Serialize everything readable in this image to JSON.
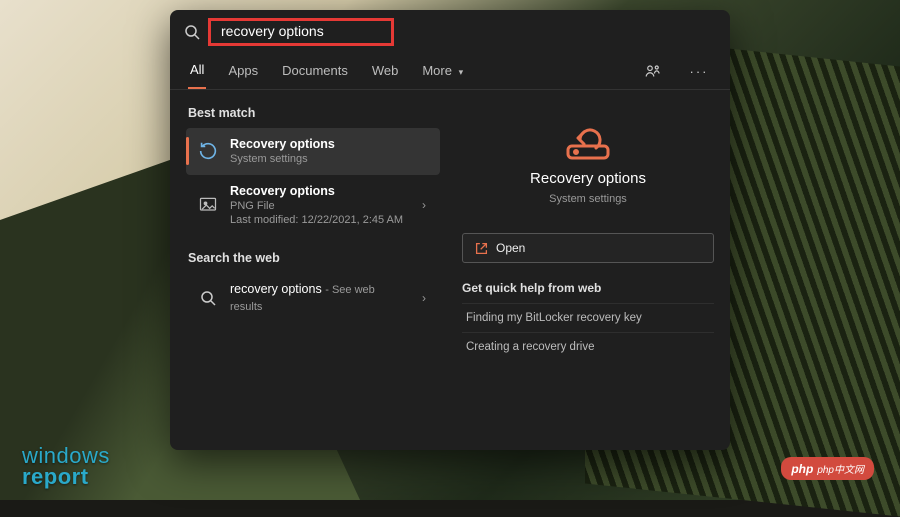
{
  "search": {
    "query": "recovery options"
  },
  "tabs": {
    "all": "All",
    "apps": "Apps",
    "documents": "Documents",
    "web": "Web",
    "more": "More"
  },
  "left": {
    "bestMatch": "Best match",
    "searchWeb": "Search the web",
    "results": {
      "r0": {
        "title": "Recovery options",
        "sub": "System settings"
      },
      "r1": {
        "title": "Recovery options",
        "sub1": "PNG File",
        "sub2": "Last modified: 12/22/2021, 2:45 AM"
      },
      "web": {
        "title": "recovery options",
        "sub": "See web results"
      }
    }
  },
  "detail": {
    "title": "Recovery options",
    "sub": "System settings",
    "open": "Open",
    "helpTitle": "Get quick help from web",
    "help1": "Finding my BitLocker recovery key",
    "help2": "Creating a recovery drive"
  },
  "watermark": {
    "left1": "windows",
    "left2": "report",
    "right": "php中文网"
  }
}
